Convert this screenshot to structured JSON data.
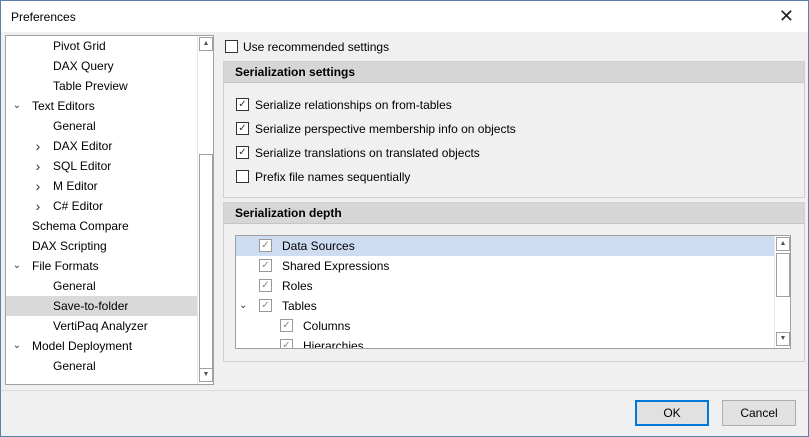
{
  "window": {
    "title": "Preferences",
    "close_icon": "close-icon"
  },
  "tree": {
    "items": [
      {
        "label": "Pivot Grid",
        "level": 2,
        "expander": ""
      },
      {
        "label": "DAX Query",
        "level": 2,
        "expander": ""
      },
      {
        "label": "Table Preview",
        "level": 2,
        "expander": ""
      },
      {
        "label": "Text Editors",
        "level": 1,
        "expander": "expanded"
      },
      {
        "label": "General",
        "level": 2,
        "expander": ""
      },
      {
        "label": "DAX Editor",
        "level": 2,
        "expander": "collapsed"
      },
      {
        "label": "SQL Editor",
        "level": 2,
        "expander": "collapsed"
      },
      {
        "label": "M Editor",
        "level": 2,
        "expander": "collapsed"
      },
      {
        "label": "C# Editor",
        "level": 2,
        "expander": "collapsed"
      },
      {
        "label": "Schema Compare",
        "level": 1,
        "expander": ""
      },
      {
        "label": "DAX Scripting",
        "level": 1,
        "expander": ""
      },
      {
        "label": "File Formats",
        "level": 1,
        "expander": "expanded"
      },
      {
        "label": "General",
        "level": 2,
        "expander": ""
      },
      {
        "label": "Save-to-folder",
        "level": 2,
        "expander": "",
        "selected": true
      },
      {
        "label": "VertiPaq Analyzer",
        "level": 2,
        "expander": ""
      },
      {
        "label": "Model Deployment",
        "level": 1,
        "expander": "expanded"
      },
      {
        "label": "General",
        "level": 2,
        "expander": ""
      }
    ]
  },
  "use_recommended": {
    "label": "Use recommended settings",
    "checked": false
  },
  "serialization_settings": {
    "title": "Serialization settings",
    "options": [
      {
        "label": "Serialize relationships on from-tables",
        "checked": true
      },
      {
        "label": "Serialize perspective membership info on objects",
        "checked": true
      },
      {
        "label": "Serialize translations on translated objects",
        "checked": true
      },
      {
        "label": "Prefix file names sequentially",
        "checked": false
      }
    ]
  },
  "serialization_depth": {
    "title": "Serialization depth",
    "items": [
      {
        "label": "Data Sources",
        "level": 1,
        "checked": true,
        "expander": "",
        "selected": true
      },
      {
        "label": "Shared Expressions",
        "level": 1,
        "checked": true,
        "expander": ""
      },
      {
        "label": "Roles",
        "level": 1,
        "checked": true,
        "expander": ""
      },
      {
        "label": "Tables",
        "level": 1,
        "checked": true,
        "expander": "expanded"
      },
      {
        "label": "Columns",
        "level": 2,
        "checked": true,
        "expander": ""
      },
      {
        "label": "Hierarchies",
        "level": 2,
        "checked": true,
        "expander": ""
      }
    ]
  },
  "buttons": {
    "ok": "OK",
    "cancel": "Cancel"
  },
  "colors": {
    "selection": "#cddcf1",
    "tree_selection": "#d9d9d9",
    "default_button_border": "#0078d7"
  }
}
